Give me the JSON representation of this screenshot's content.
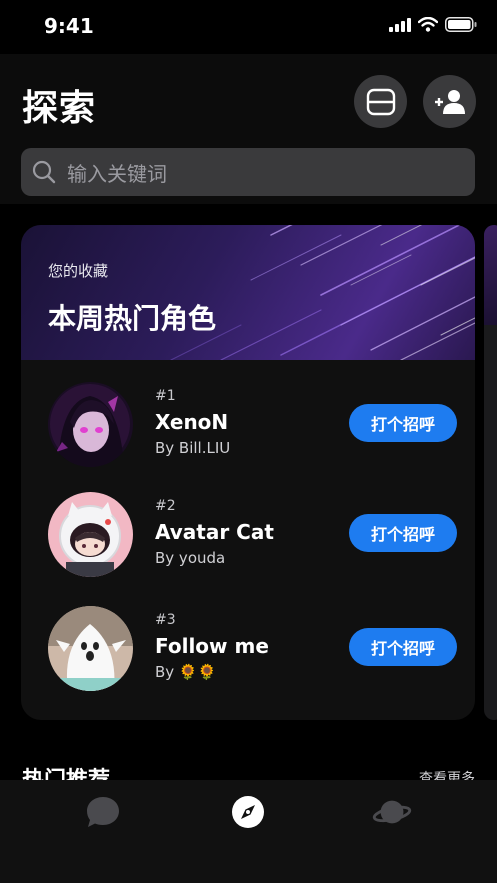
{
  "status": {
    "time": "9:41"
  },
  "header": {
    "title": "探索"
  },
  "search": {
    "placeholder": "输入关键词"
  },
  "card": {
    "subtitle": "您的收藏",
    "title": "本周热门角色",
    "items": [
      {
        "rank": "#1",
        "name": "XenoN",
        "author": "By  Bill.LIU",
        "button": "打个招呼"
      },
      {
        "rank": "#2",
        "name": "Avatar Cat",
        "author": "By  youda",
        "button": "打个招呼"
      },
      {
        "rank": "#3",
        "name": "Follow me",
        "author": "By  🌻🌻",
        "button": "打个招呼"
      }
    ]
  },
  "section": {
    "title": "热门推荐",
    "more": "查看更多"
  },
  "tabs": {
    "active": "discover"
  },
  "colors": {
    "accent": "#1e7cf0",
    "background": "#000000"
  },
  "icons": [
    "signal-icon",
    "wifi-icon",
    "battery-icon",
    "scan-icon",
    "add-friend-icon",
    "search-icon",
    "chat-icon",
    "compass-icon",
    "planet-icon"
  ]
}
